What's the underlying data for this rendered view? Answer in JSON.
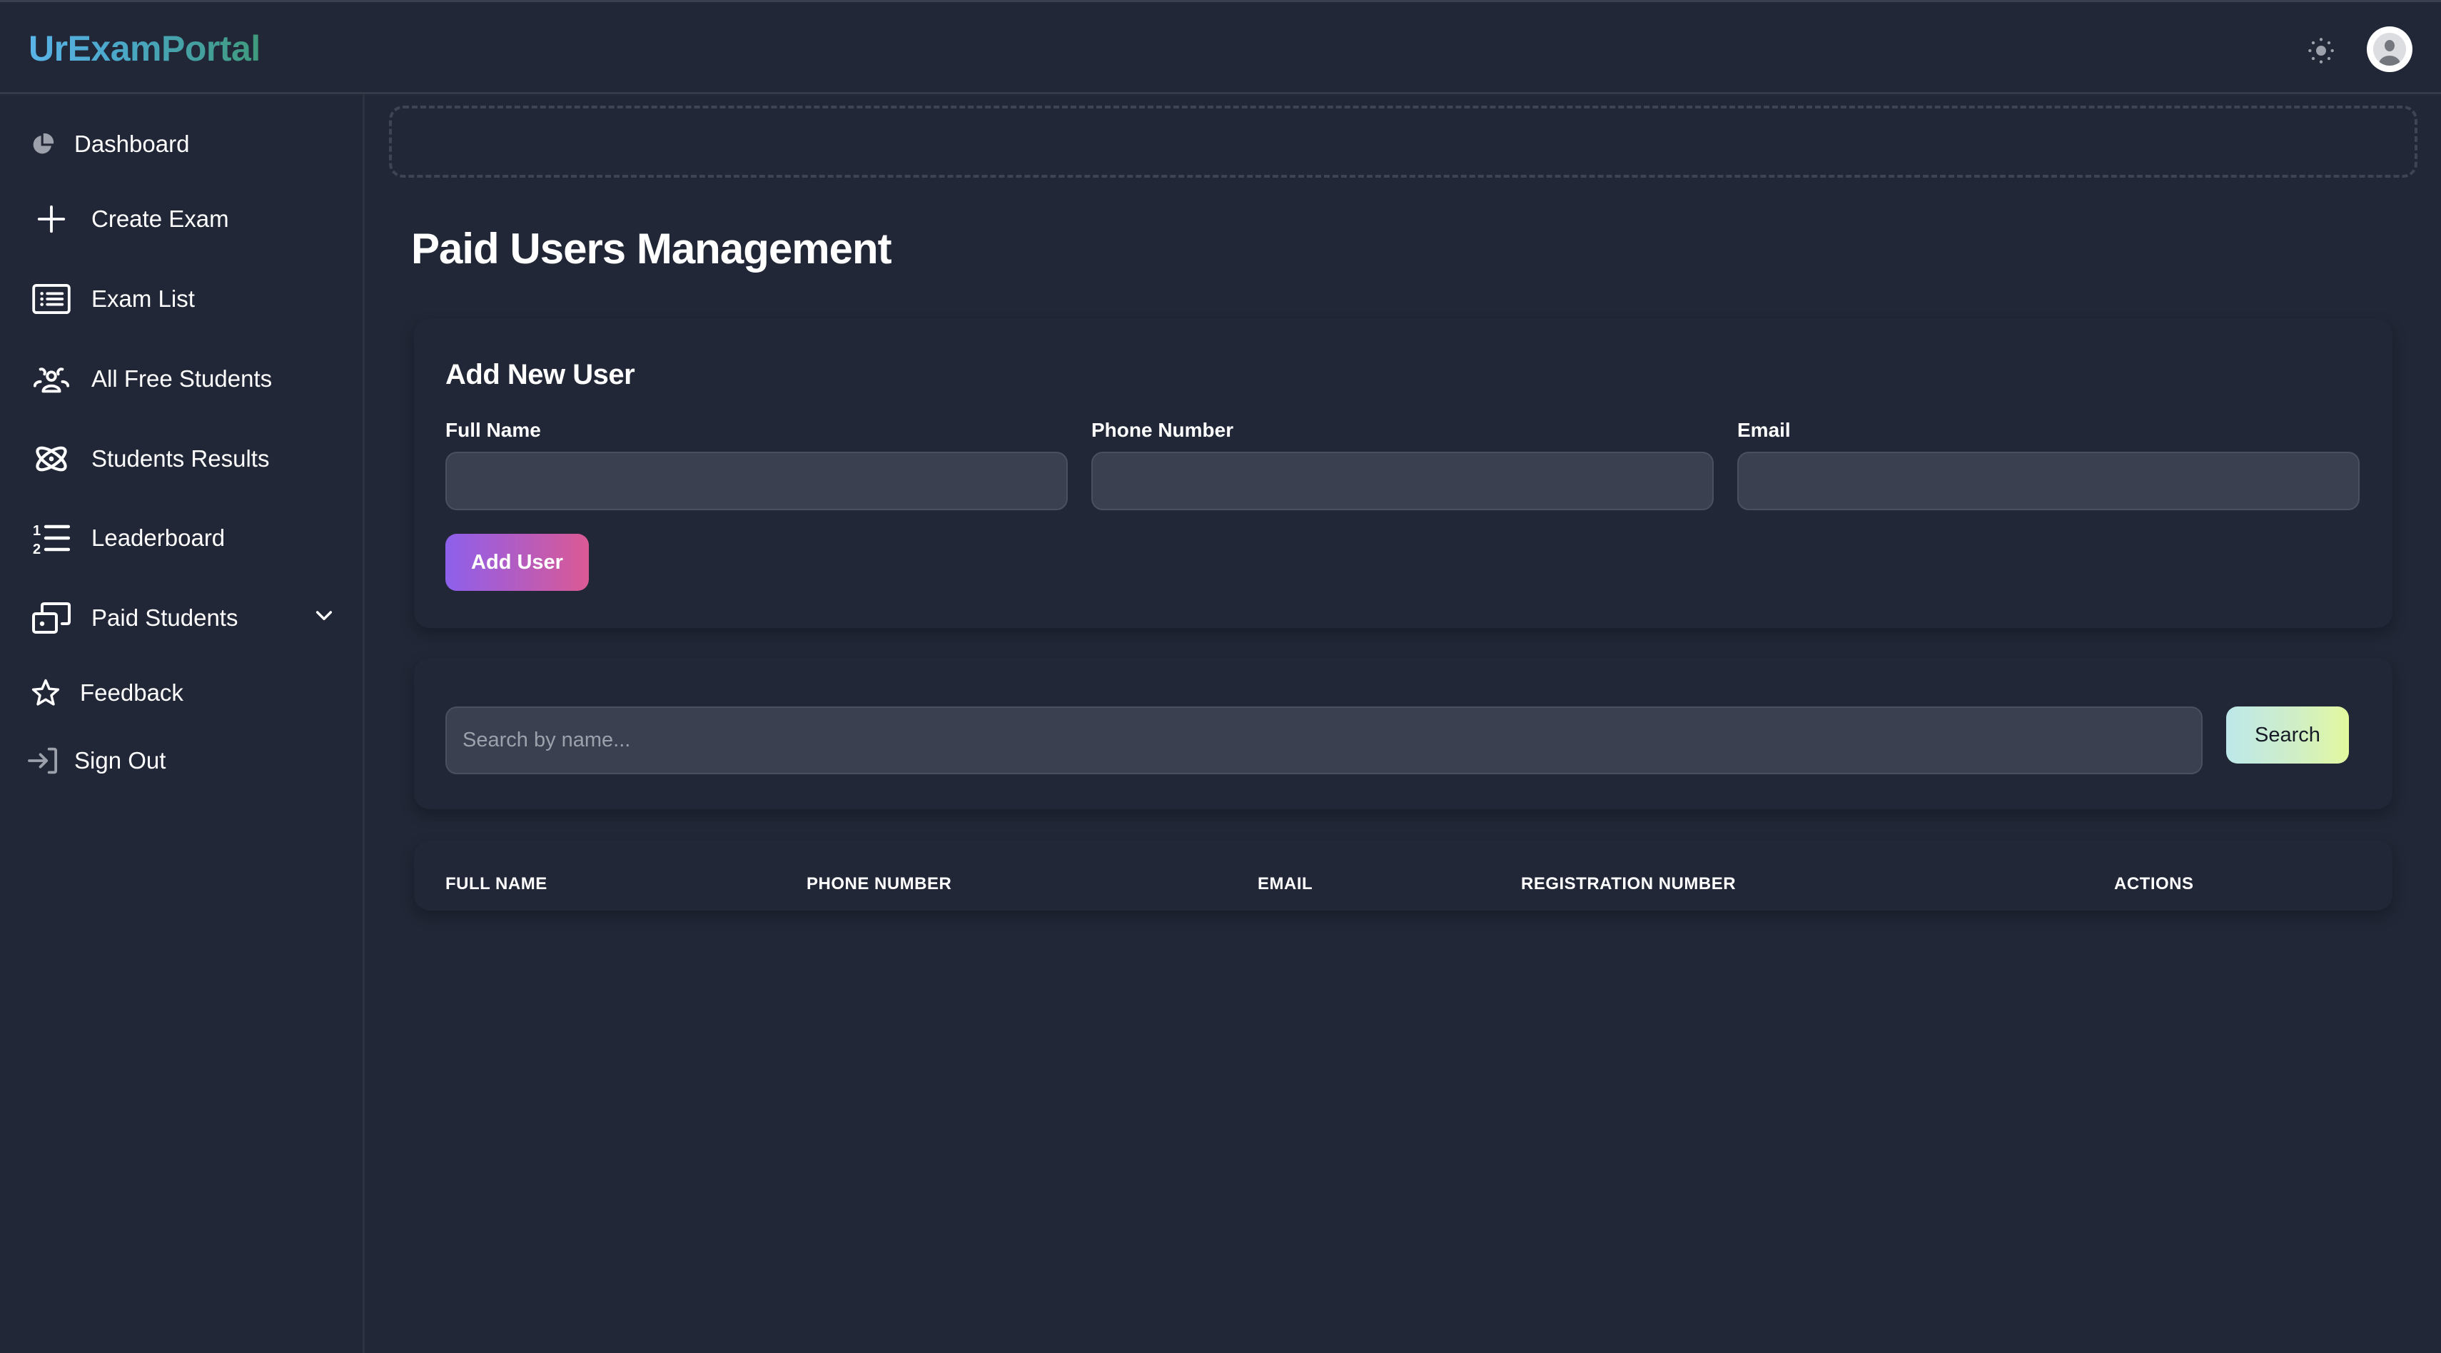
{
  "header": {
    "logo": "UrExamPortal",
    "theme_toggle_icon": "sun-icon",
    "avatar_icon": "user-avatar-icon"
  },
  "sidebar": {
    "items": [
      {
        "label": "Dashboard",
        "icon": "pie-chart-icon"
      },
      {
        "label": "Create Exam",
        "icon": "plus-icon"
      },
      {
        "label": "Exam List",
        "icon": "list-box-icon"
      },
      {
        "label": "All Free Students",
        "icon": "users-group-icon"
      },
      {
        "label": "Students Results",
        "icon": "atom-icon"
      },
      {
        "label": "Leaderboard",
        "icon": "numbered-list-icon"
      },
      {
        "label": "Paid Students",
        "icon": "money-icon",
        "has_submenu": true,
        "expanded": false
      },
      {
        "label": "Feedback",
        "icon": "star-icon"
      },
      {
        "label": "Sign Out",
        "icon": "sign-out-icon"
      }
    ]
  },
  "main": {
    "page_title": "Paid Users Management",
    "add_user_form": {
      "title": "Add New User",
      "fields": [
        {
          "label": "Full Name",
          "value": "",
          "placeholder": ""
        },
        {
          "label": "Phone Number",
          "value": "",
          "placeholder": ""
        },
        {
          "label": "Email",
          "value": "",
          "placeholder": ""
        }
      ],
      "submit_label": "Add User"
    },
    "search": {
      "placeholder": "Search by name...",
      "value": "",
      "button_label": "Search"
    },
    "table": {
      "columns": [
        "FULL NAME",
        "PHONE NUMBER",
        "EMAIL",
        "REGISTRATION NUMBER",
        "ACTIONS"
      ],
      "rows": []
    }
  },
  "colors": {
    "background": "#212736",
    "input_bg": "#3a4050",
    "logo_gradient": [
      "#5ab4e8",
      "#3f9a7c"
    ],
    "add_button_gradient": [
      "#8d60ec",
      "#db5a94"
    ],
    "search_button_gradient": [
      "#bde8ea",
      "#e2f89e"
    ]
  }
}
